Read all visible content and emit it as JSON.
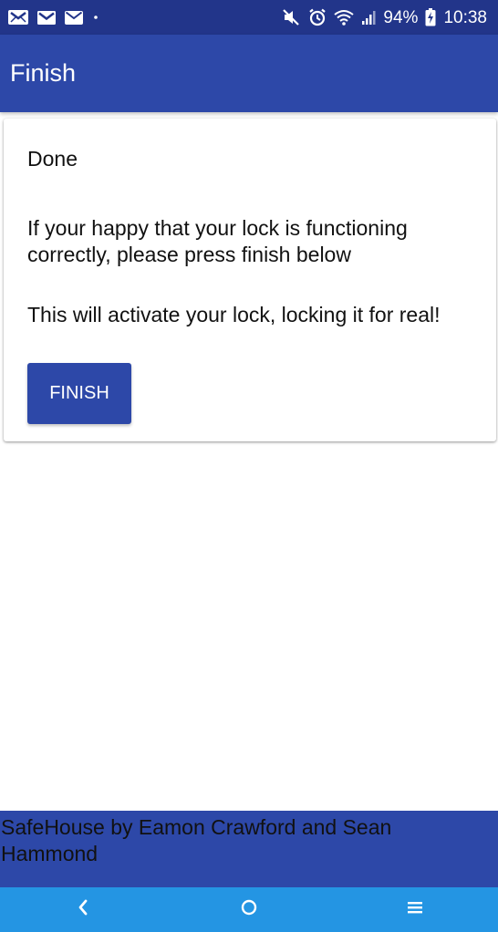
{
  "status_bar": {
    "battery": "94%",
    "time": "10:38",
    "left_icons": [
      "gallery-mail-icon",
      "gmail-icon",
      "email-icon",
      "dot-icon"
    ],
    "right_icons": [
      "mute-icon",
      "alarm-icon",
      "wifi-icon",
      "signal-icon",
      "battery-charging-icon"
    ]
  },
  "app_bar": {
    "title": "Finish"
  },
  "card": {
    "title": "Done",
    "message": "If your happy that your lock is functioning correctly, please press finish below",
    "warning": "This will activate your lock, locking it for real!",
    "finish_label": "FINISH"
  },
  "footer": {
    "credits": "SafeHouse by Eamon Crawford and Sean Hammond"
  },
  "nav_bar": {
    "icons": [
      "back-icon",
      "home-icon",
      "recents-icon"
    ]
  },
  "colors": {
    "status_bar": "#22358a",
    "primary": "#2d48a8",
    "nav_bar": "#2495e3",
    "text": "#111111"
  }
}
